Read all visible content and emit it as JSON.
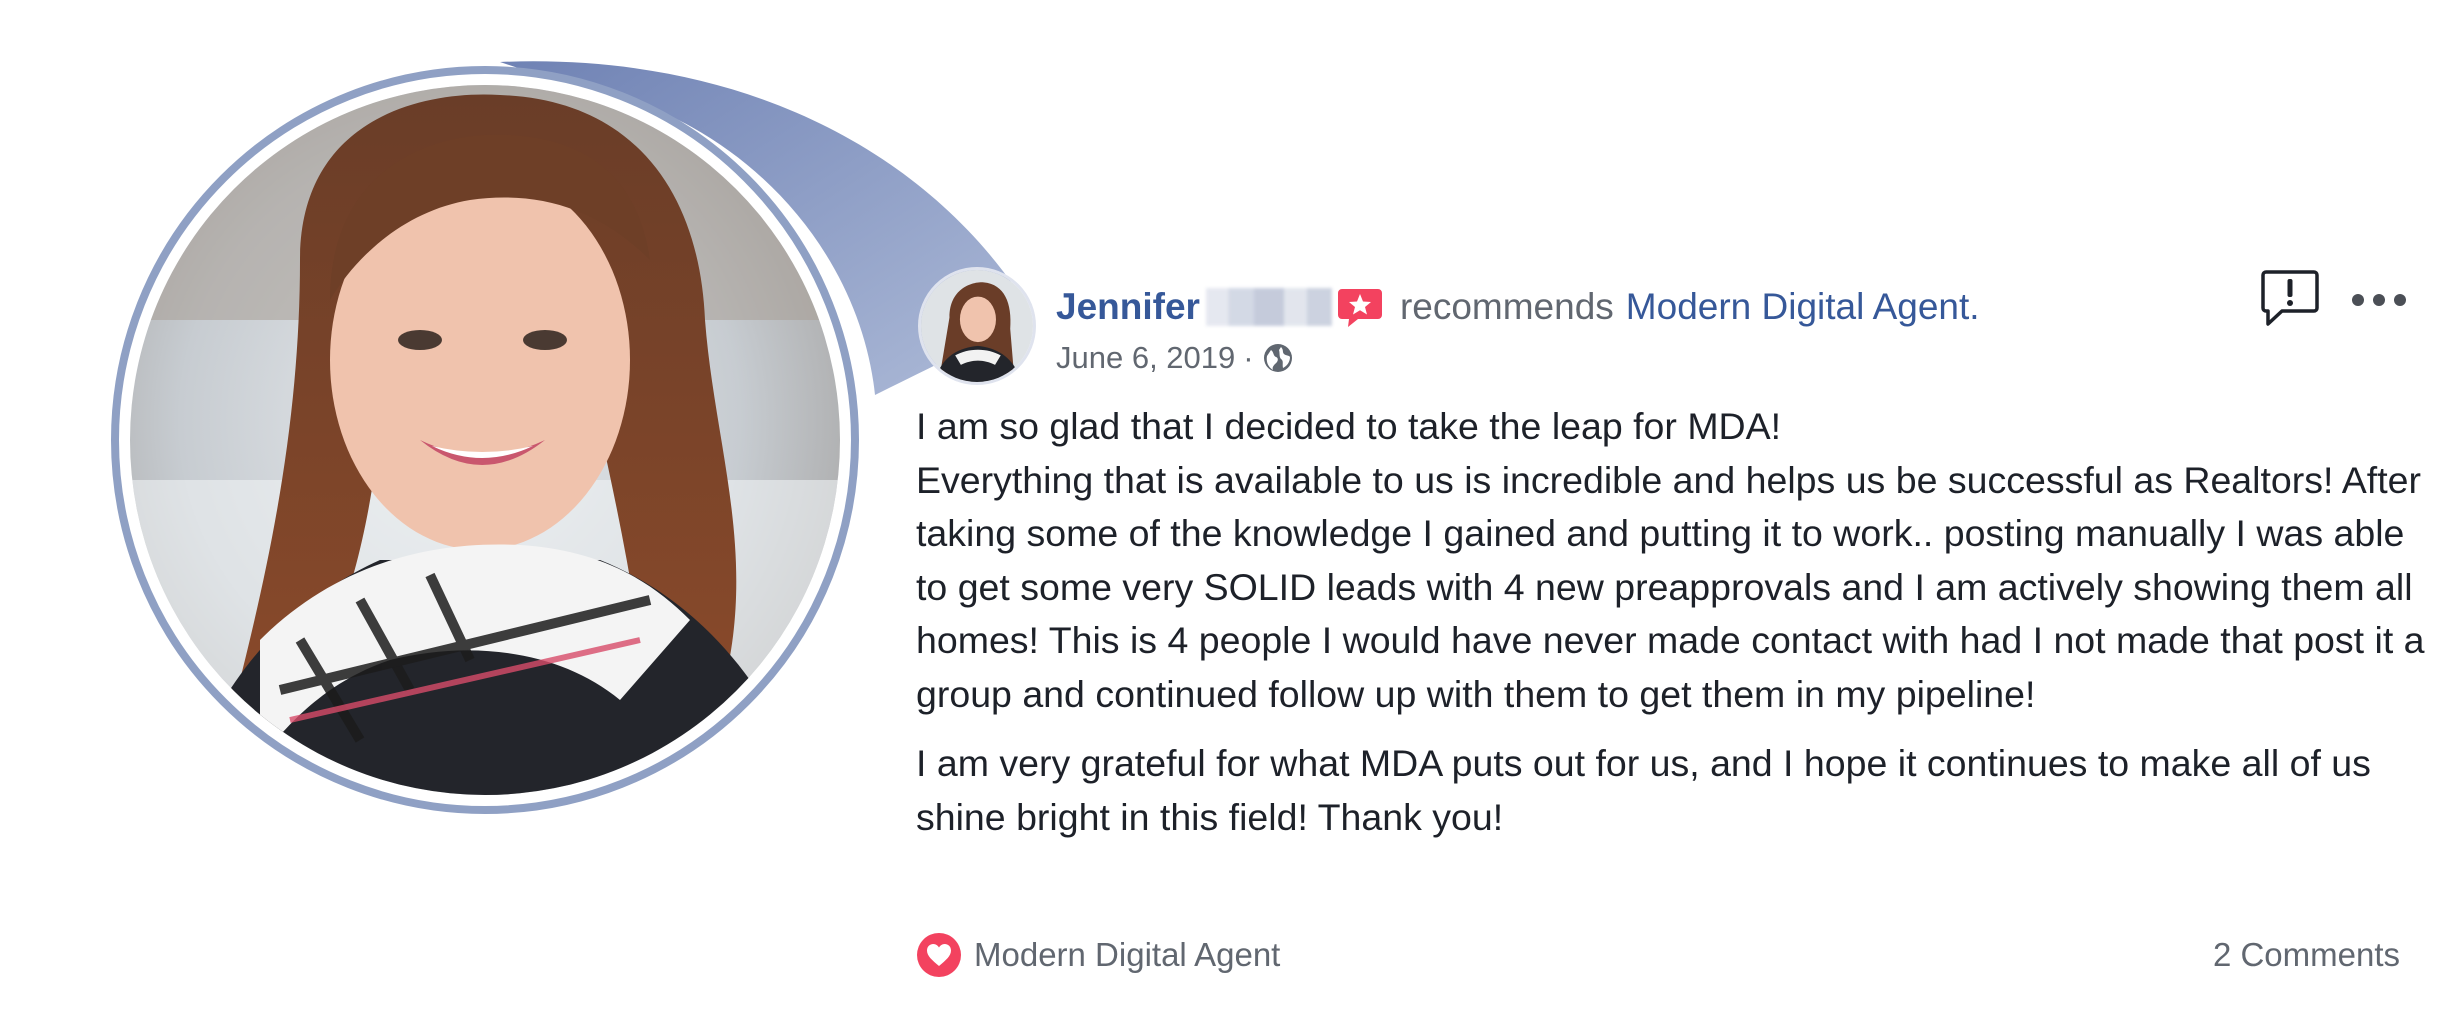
{
  "review": {
    "author_first_name": "Jennifer",
    "recommends_text": "recommends",
    "page_name": "Modern Digital Agent.",
    "date": "June 6, 2019",
    "date_separator": "·",
    "paragraphs": [
      "I am so glad that I decided to take the leap for MDA!\nEverything that is available to us is incredible and helps us be successful as Realtors! After taking some of the knowledge I gained and putting it to work.. posting manually I was able to get some very SOLID leads with 4 new preapprovals and I am actively showing them all homes! This is 4 people I would have never made contact with had I not made that post it a group and continued follow up with them to get them in my pipeline!",
      "I am very grateful for what MDA puts out for us, and I hope it continues to make all of us shine bright in this field! Thank you!"
    ],
    "footer": {
      "reaction_label": "Modern Digital Agent",
      "comments_label": "2 Comments"
    }
  },
  "icons": {
    "recommendation_badge": "recommend-star-icon",
    "privacy": "globe-icon",
    "report": "report-icon",
    "more": "more-options-icon",
    "reaction": "love-heart-icon"
  },
  "colors": {
    "link_blue": "#365899",
    "secondary_text": "#616770",
    "body_text": "#1d2129",
    "recommend_red": "#f3425f",
    "portrait_ring": "#8fa0c4"
  }
}
